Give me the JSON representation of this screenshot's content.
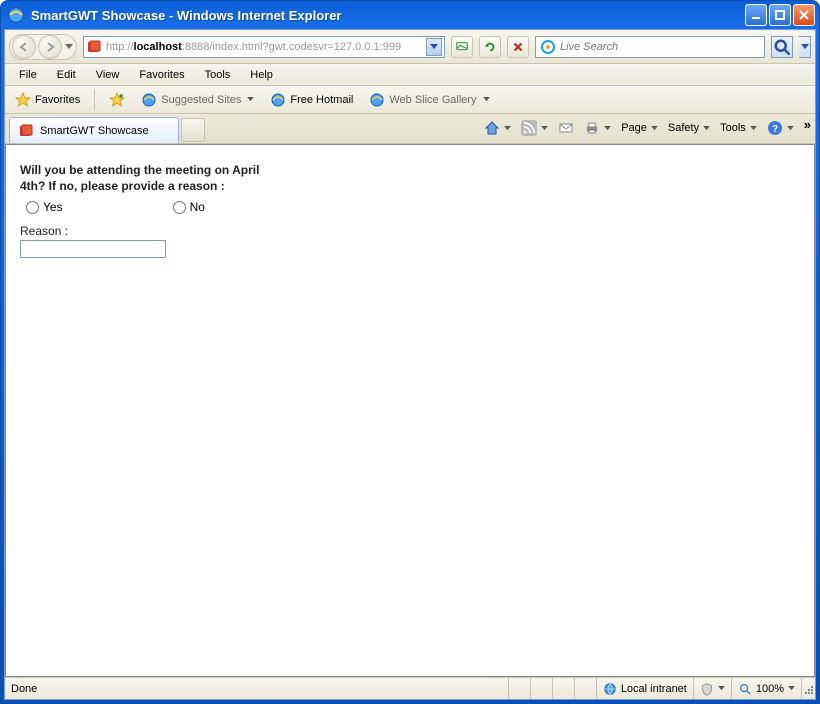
{
  "window": {
    "title": "SmartGWT Showcase - Windows Internet Explorer"
  },
  "address": {
    "url_prefix": "http://",
    "url_host": "localhost",
    "url_suffix": ":8888/index.html?gwt.codesvr=127.0.0.1:999"
  },
  "search": {
    "placeholder": "Live Search"
  },
  "menus": {
    "file": "File",
    "edit": "Edit",
    "view": "View",
    "favorites": "Favorites",
    "tools": "Tools",
    "help": "Help"
  },
  "favbar": {
    "favorites_btn": "Favorites",
    "suggested": "Suggested Sites",
    "hotmail": "Free Hotmail",
    "webslice": "Web Slice Gallery"
  },
  "tab": {
    "title": "SmartGWT Showcase"
  },
  "cmdbar": {
    "page": "Page",
    "safety": "Safety",
    "tools": "Tools"
  },
  "form": {
    "question": "Will you be attending the meeting on April 4th? If no, please provide a reason :",
    "yes": "Yes",
    "no": "No",
    "reason_label": "Reason :",
    "reason_value": ""
  },
  "status": {
    "done": "Done",
    "zone": "Local intranet",
    "zoom": "100%"
  }
}
